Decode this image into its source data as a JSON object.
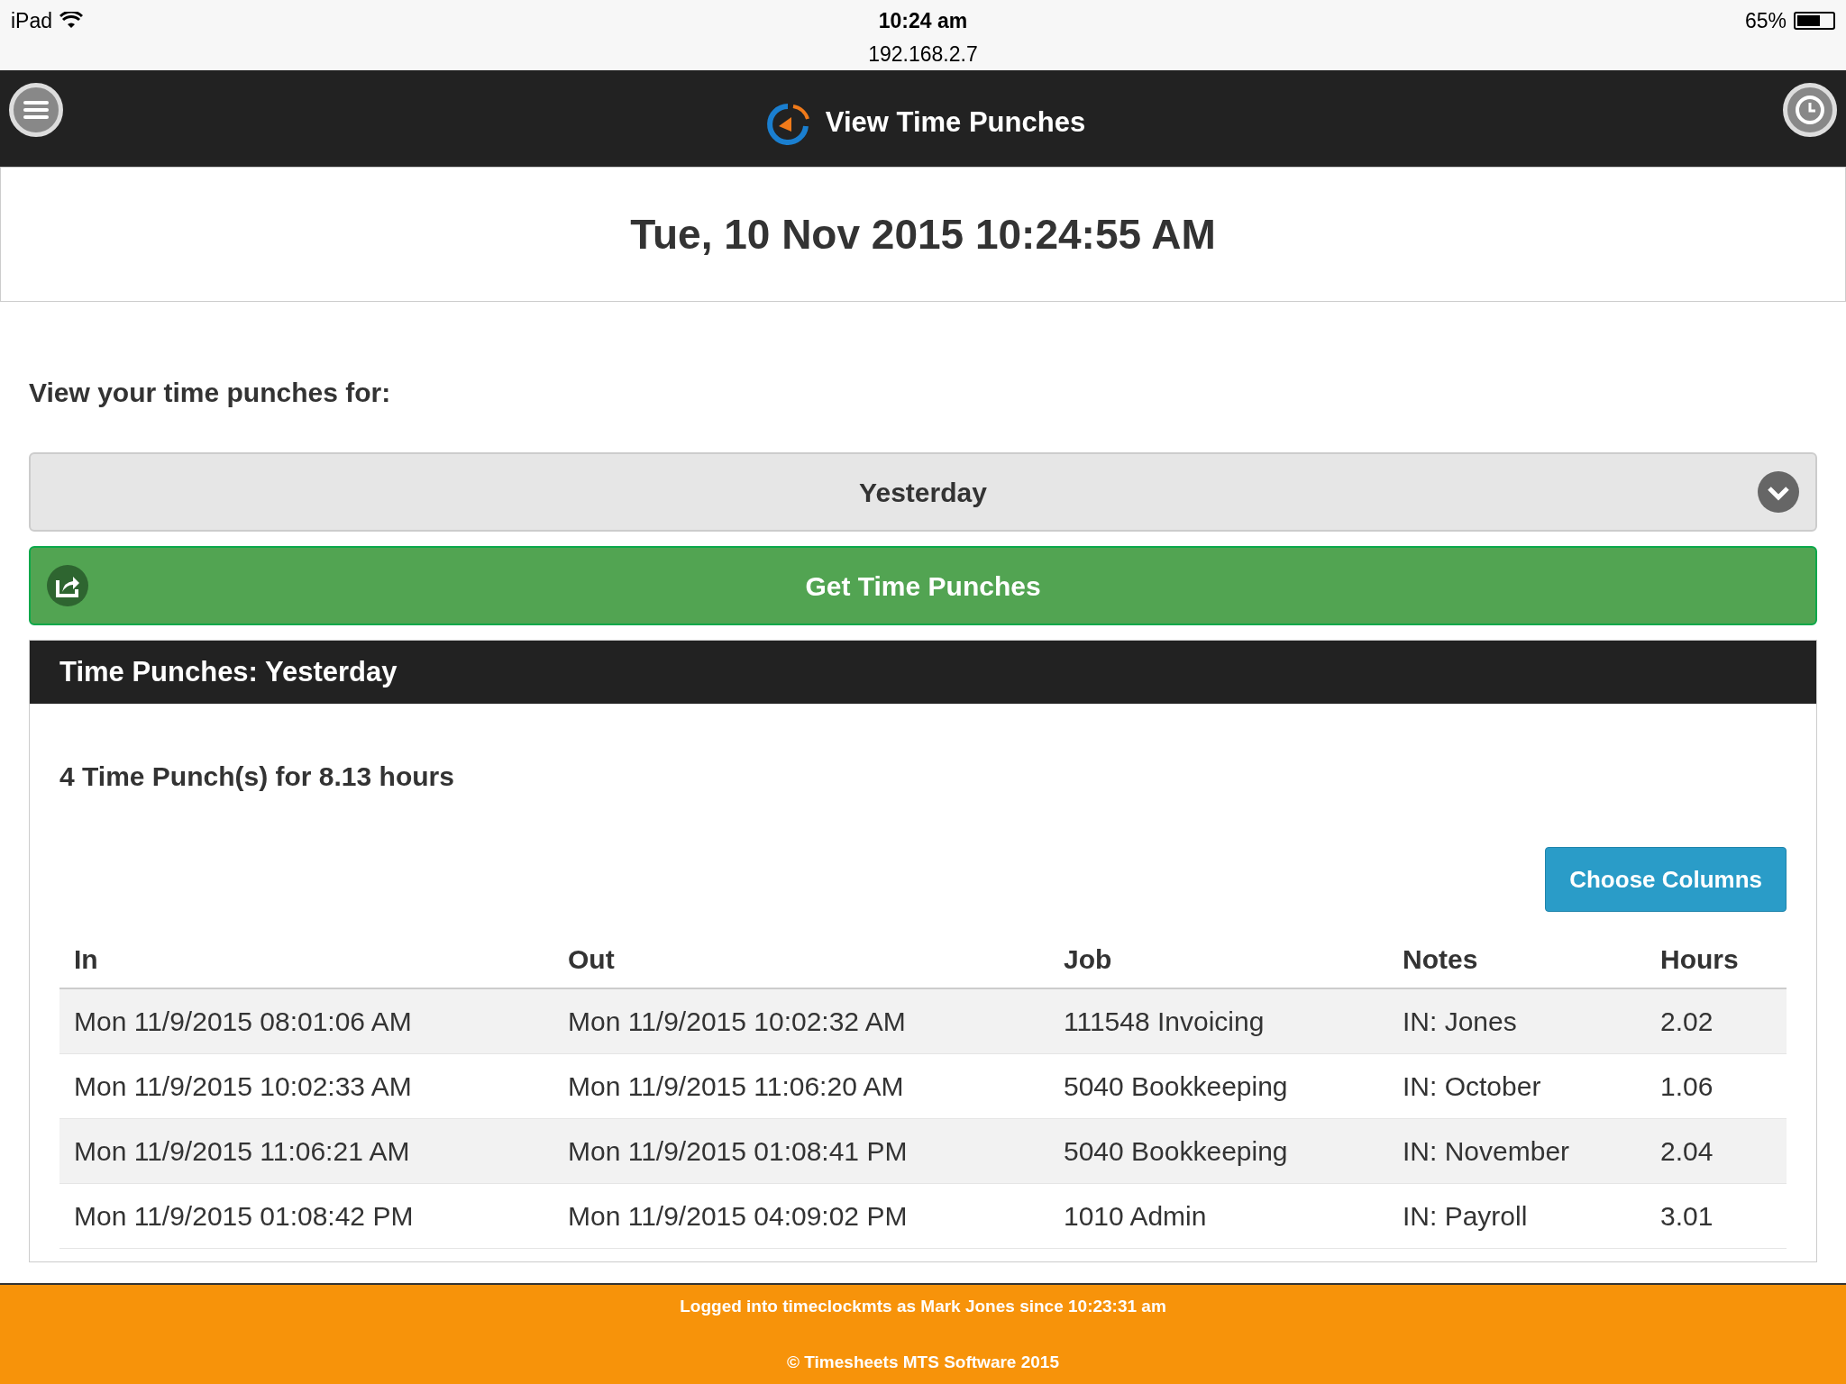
{
  "status_bar": {
    "device": "iPad",
    "time": "10:24 am",
    "address": "192.168.2.7",
    "battery": "65%",
    "battery_meter": {
      "level": 0.65
    }
  },
  "header": {
    "title": "View Time Punches"
  },
  "current_datetime": "Tue, 10 Nov 2015 10:24:55 AM",
  "period_label": "View your time punches for:",
  "period_select": {
    "value": "Yesterday"
  },
  "get_button": "Get Time Punches",
  "panel": {
    "title": "Time Punches: Yesterday",
    "summary": "4 Time Punch(s) for 8.13 hours",
    "choose_columns_button": "Choose Columns",
    "table": {
      "columns": [
        "In",
        "Out",
        "Job",
        "Notes",
        "Hours"
      ],
      "rows": [
        [
          "Mon 11/9/2015 08:01:06 AM",
          "Mon 11/9/2015 10:02:32 AM",
          "111548 Invoicing",
          "IN: Jones",
          "2.02"
        ],
        [
          "Mon 11/9/2015 10:02:33 AM",
          "Mon 11/9/2015 11:06:20 AM",
          "5040 Bookkeeping",
          "IN: October",
          "1.06"
        ],
        [
          "Mon 11/9/2015 11:06:21 AM",
          "Mon 11/9/2015 01:08:41 PM",
          "5040 Bookkeeping",
          "IN: November",
          "2.04"
        ],
        [
          "Mon 11/9/2015 01:08:42 PM",
          "Mon 11/9/2015 04:09:02 PM",
          "1010 Admin",
          "IN: Payroll",
          "3.01"
        ]
      ]
    }
  },
  "footer": {
    "login": "Logged into timeclockmts as Mark Jones since 10:23:31 am",
    "copyright": "© Timesheets MTS Software 2015"
  }
}
